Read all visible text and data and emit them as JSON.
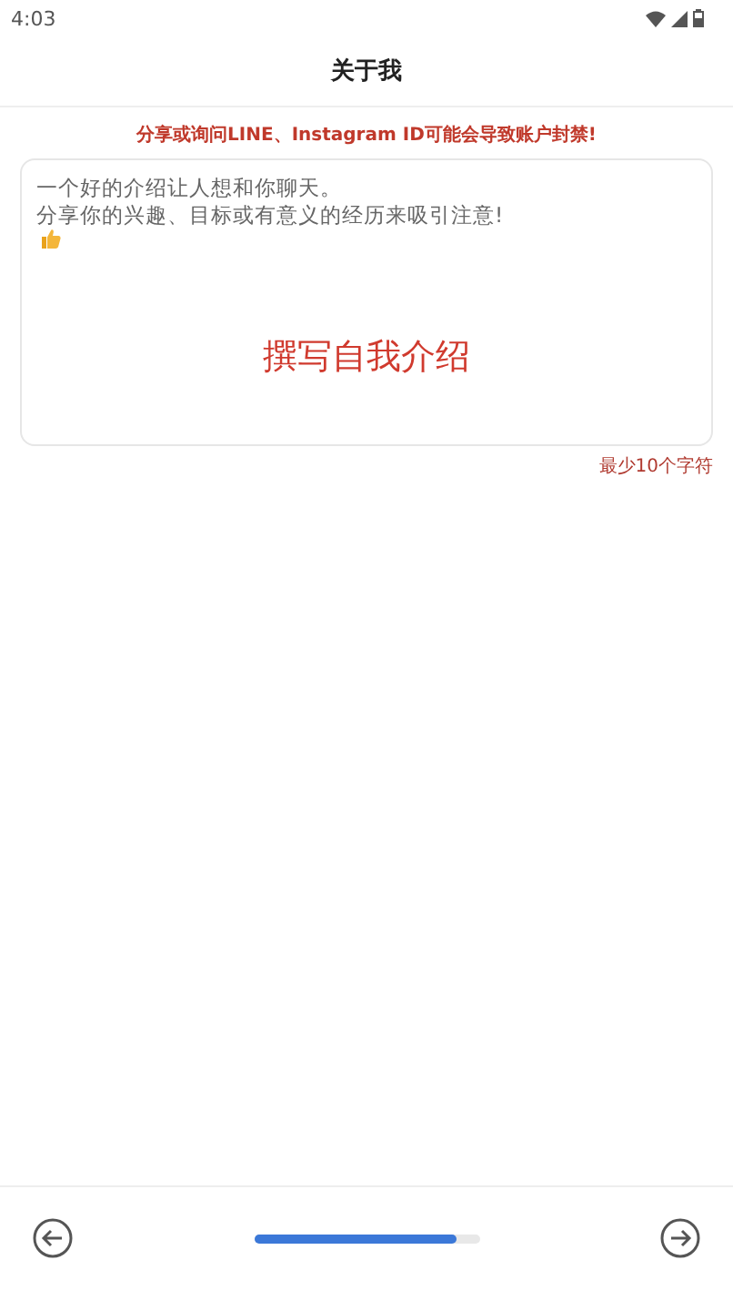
{
  "status_bar": {
    "time": "4:03"
  },
  "header": {
    "title": "关于我"
  },
  "warning": "分享或询问LINE、Instagram ID可能会导致账户封禁!",
  "intro_field": {
    "hint_lines": [
      "一个好的介绍让人想和你聊天。",
      "分享你的兴趣、目标或有意义的经历来吸引注意!"
    ],
    "prompt": "撰写自我介绍"
  },
  "min_length_hint": "最少10个字符",
  "footer": {
    "progress": {
      "level": 0.9
    }
  }
}
